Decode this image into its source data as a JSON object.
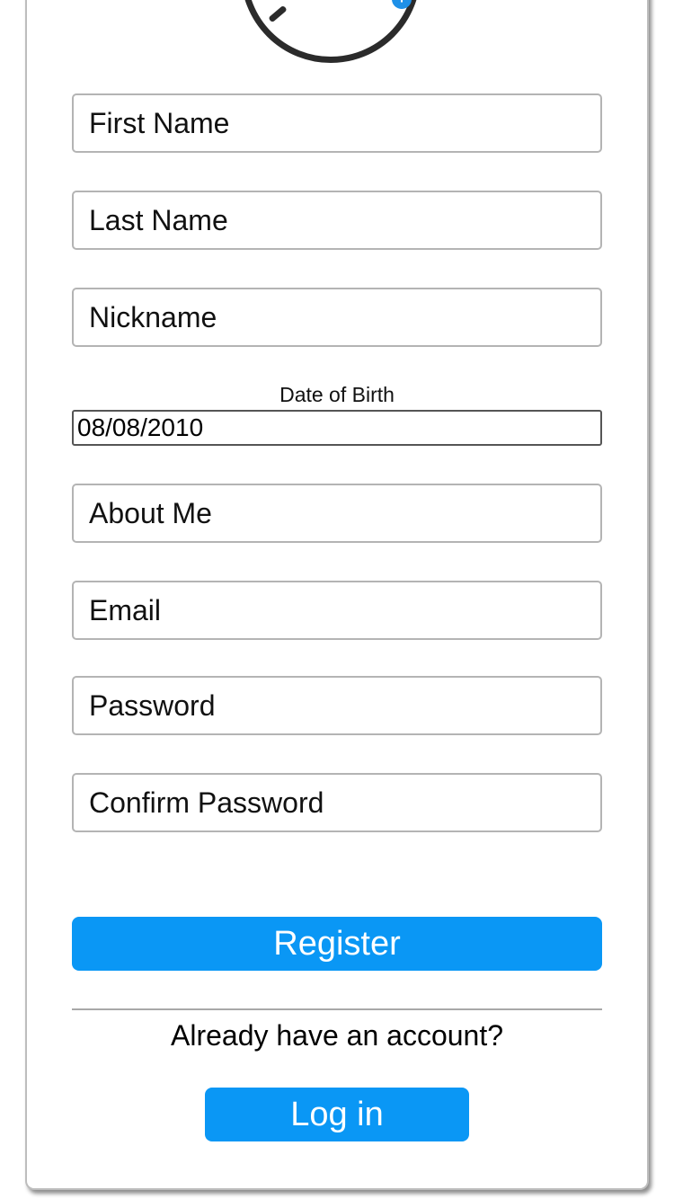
{
  "avatar": {
    "add_icon": "plus-icon",
    "accent_color": "#1e90e8"
  },
  "form": {
    "first_name": {
      "placeholder": "First Name",
      "value": ""
    },
    "last_name": {
      "placeholder": "Last Name",
      "value": ""
    },
    "nickname": {
      "placeholder": "Nickname",
      "value": ""
    },
    "date_of_birth": {
      "label": "Date of Birth",
      "value": "08/08/2010"
    },
    "about_me": {
      "placeholder": "About Me",
      "value": ""
    },
    "email": {
      "placeholder": "Email",
      "value": ""
    },
    "password": {
      "placeholder": "Password",
      "value": ""
    },
    "confirm_password": {
      "placeholder": "Confirm Password",
      "value": ""
    }
  },
  "actions": {
    "register_label": "Register",
    "already_text": "Already have an account?",
    "login_label": "Log in",
    "button_color": "#0a97f5"
  }
}
